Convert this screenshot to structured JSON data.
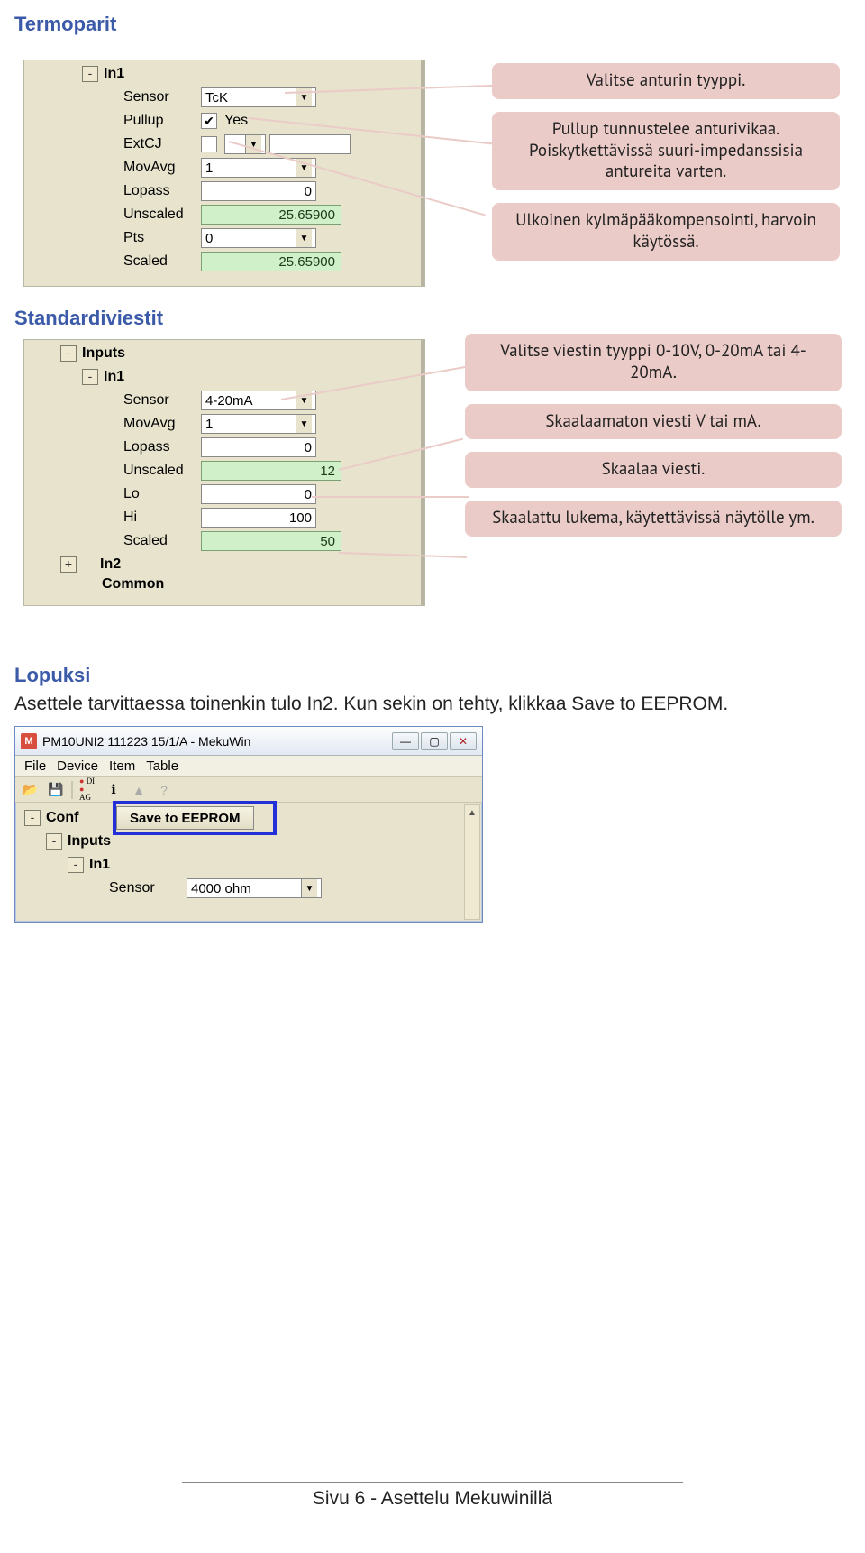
{
  "sections": {
    "termoparit_title": "Termoparit",
    "standardiviestit_title": "Standardiviestit",
    "lopuksi_title": "Lopuksi",
    "lopuksi_body": "Asettele tarvittaessa toinenkin tulo In2. Kun sekin on tehty, klikkaa Save to EEPROM."
  },
  "panel1": {
    "node_in1": "In1",
    "rows": {
      "sensor_label": "Sensor",
      "sensor_value": "TcK",
      "pullup_label": "Pullup",
      "pullup_value": "Yes",
      "extcj_label": "ExtCJ",
      "movavg_label": "MovAvg",
      "movavg_value": "1",
      "lopass_label": "Lopass",
      "lopass_value": "0",
      "unscaled_label": "Unscaled",
      "unscaled_value": "25.65900",
      "pts_label": "Pts",
      "pts_value": "0",
      "scaled_label": "Scaled",
      "scaled_value": "25.65900"
    }
  },
  "callouts1": {
    "a": "Valitse anturin tyyppi.",
    "b": "Pullup tunnustelee anturivikaa. Poiskytkettävissä suuri-impedanssisia antureita varten.",
    "c": "Ulkoinen kylmäpääkompensointi, harvoin käytössä."
  },
  "panel2": {
    "node_inputs": "Inputs",
    "node_in1": "In1",
    "node_in2": "In2",
    "node_common": "Common",
    "rows": {
      "sensor_label": "Sensor",
      "sensor_value": "4-20mA",
      "movavg_label": "MovAvg",
      "movavg_value": "1",
      "lopass_label": "Lopass",
      "lopass_value": "0",
      "unscaled_label": "Unscaled",
      "unscaled_value": "12",
      "lo_label": "Lo",
      "lo_value": "0",
      "hi_label": "Hi",
      "hi_value": "100",
      "scaled_label": "Scaled",
      "scaled_value": "50"
    }
  },
  "callouts2": {
    "a": "Valitse viestin tyyppi 0-10V, 0-20mA tai 4-20mA.",
    "b": "Skaalaamaton viesti V tai mA.",
    "c": "Skaalaa viesti.",
    "d": "Skaalattu lukema, käytettävissä näytölle ym."
  },
  "win": {
    "title": "PM10UNI2 111223 15/1/A - MekuWin",
    "menu": {
      "file": "File",
      "device": "Device",
      "item": "Item",
      "table": "Table"
    },
    "diag": {
      "d1": "DI",
      "d2": "AG"
    },
    "save_btn": "Save to EEPROM",
    "tree": {
      "conf": "Conf",
      "inputs": "Inputs",
      "in1": "In1",
      "sensor_label": "Sensor",
      "sensor_value": "4000 ohm"
    }
  },
  "footer": {
    "text_prefix": "Sivu 6 - ",
    "text_topic": "Asettelu Mekuwinillä"
  }
}
